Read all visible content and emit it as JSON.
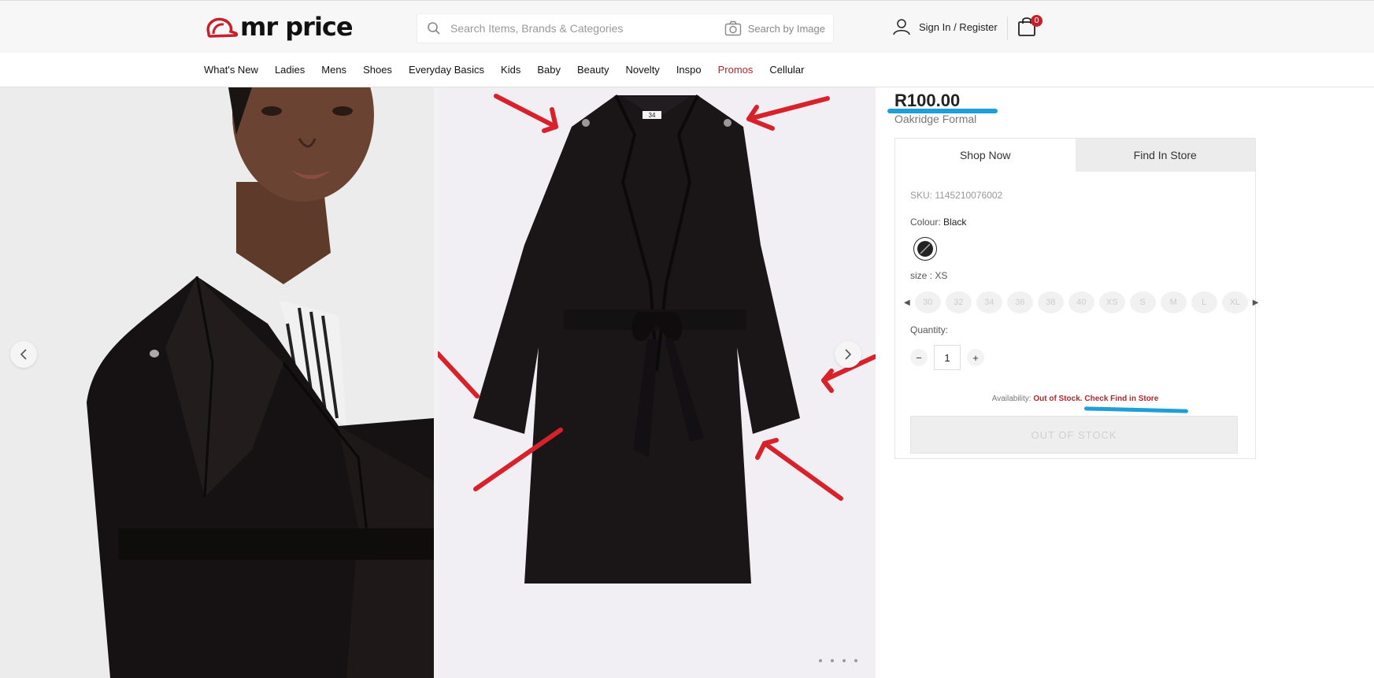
{
  "header": {
    "logo_text": "mr price",
    "search_placeholder": "Search Items, Brands & Categories",
    "image_search_label": "Search by Image",
    "account_label": "Sign In / Register",
    "cart_count": "0"
  },
  "nav": {
    "items": [
      "What's New",
      "Ladies",
      "Mens",
      "Shoes",
      "Everyday Basics",
      "Kids",
      "Baby",
      "Beauty",
      "Novelty",
      "Inspo",
      "Promos",
      "Cellular"
    ]
  },
  "product": {
    "price": "R100.00",
    "name": "Oakridge Formal",
    "tabs": [
      "Shop Now",
      "Find In Store"
    ],
    "sku": "SKU: 1145210076002",
    "colour_label": "Colour:",
    "colour_value": "Black",
    "size_label": "size :",
    "size_value": "XS",
    "sizes": [
      "30",
      "32",
      "34",
      "36",
      "38",
      "40",
      "XS",
      "S",
      "M",
      "L",
      "XL"
    ],
    "quantity_label": "Quantity:",
    "quantity": "1",
    "availability_label": "Availability:",
    "availability_status": "Out of Stock.",
    "availability_link": "Check Find in Store",
    "button_label": "OUT OF STOCK",
    "garment_tag": "34"
  },
  "colors": {
    "accent_red": "#b1262c",
    "annotation_red": "#d8222b",
    "annotation_blue": "#1e9fd8",
    "badge": "#c8202a"
  }
}
